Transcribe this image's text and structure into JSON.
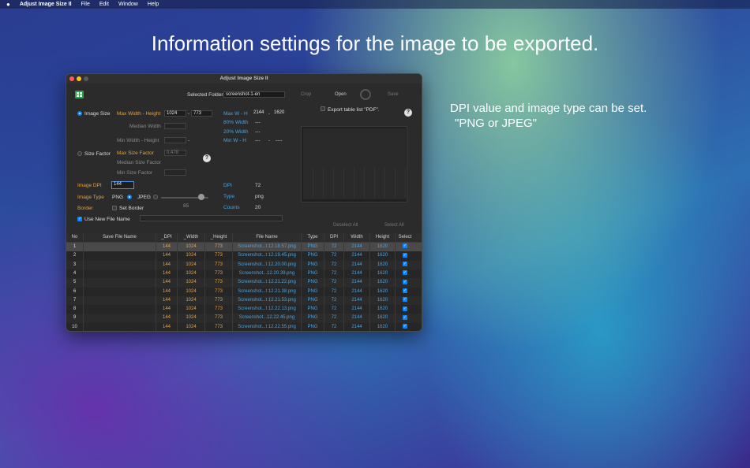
{
  "menubar": {
    "apple": "",
    "app": "Adjust Image Size II",
    "items": [
      "File",
      "Edit",
      "Window",
      "Help"
    ]
  },
  "headline": "Information settings for the image to be exported.",
  "side_note": [
    "DPI value and image type can be set.",
    "\"PNG or JPEG\""
  ],
  "window": {
    "title": "Adjust Image Size II",
    "toolbar": {
      "selected_folder_label": "Selected Folder",
      "selected_folder_value": "screenshot-1-en",
      "crop": "Crop",
      "open": "Open",
      "save": "Save"
    },
    "export_pdf_label": "Export table list \"PDF\".",
    "image_size": {
      "label": "Image Size",
      "max_wh_label": "Max Width - Height",
      "max_w": "1024",
      "max_h": "773",
      "median_width_label": "Median Width",
      "min_wh_label": "Min Width - Height",
      "dash": "-"
    },
    "right_info": {
      "max_wh_label": "Max W - H",
      "max_w": "2144",
      "max_h": "1620",
      "w80_label": "80% Width",
      "w80": "---",
      "w20_label": "20% Width",
      "w20": "---",
      "min_wh_label": "Min W - H",
      "min_w": "---",
      "min_h": "----"
    },
    "size_factor": {
      "label": "Size Factor",
      "max_label": "Max Size Factor",
      "max_value": "0.478",
      "median_label": "Median Size Factor",
      "min_label": "Min Size Factor"
    },
    "image_dpi_label": "Image DPI",
    "image_dpi_value": "144",
    "image_type_label": "Image Type",
    "png": "PNG",
    "jpeg": "JPEG",
    "quality": "85",
    "quality_fraction": 0.85,
    "border_label": "Border",
    "set_border": "Set Border",
    "use_new_file_name": "Use New File Name",
    "stats": {
      "dpi_label": "DPI",
      "dpi": "72",
      "type_label": "Type",
      "type": "png",
      "counts_label": "Counts",
      "counts": "20"
    },
    "deselect_all": "Deselect All",
    "select_all": "Select All",
    "table": {
      "headers": [
        "No",
        "Save File Name",
        "_DPI",
        "_Width",
        "_Height",
        "File Name",
        "Type",
        "DPI",
        "Width",
        "Height",
        "Select"
      ],
      "rows": [
        [
          "1",
          "",
          "144",
          "1024",
          "773",
          "Screenshot...t 12.18.57.png",
          "PNG",
          "72",
          "2144",
          "1620"
        ],
        [
          "2",
          "",
          "144",
          "1024",
          "773",
          "Screenshot...t 12.19.45.png",
          "PNG",
          "72",
          "2144",
          "1620"
        ],
        [
          "3",
          "",
          "144",
          "1024",
          "773",
          "Screenshot...t 12.20.00.png",
          "PNG",
          "72",
          "2144",
          "1620"
        ],
        [
          "4",
          "",
          "144",
          "1024",
          "773",
          "Screenshot...12.20.39.png",
          "PNG",
          "72",
          "2144",
          "1620"
        ],
        [
          "5",
          "",
          "144",
          "1024",
          "773",
          "Screenshot...t 12.21.22.png",
          "PNG",
          "72",
          "2144",
          "1620"
        ],
        [
          "6",
          "",
          "144",
          "1024",
          "773",
          "Screenshot...t 12.21.38.png",
          "PNG",
          "72",
          "2144",
          "1620"
        ],
        [
          "7",
          "",
          "144",
          "1024",
          "773",
          "Screenshot...t 12.21.53.png",
          "PNG",
          "72",
          "2144",
          "1620"
        ],
        [
          "8",
          "",
          "144",
          "1024",
          "773",
          "Screenshot...t 12.22.13.png",
          "PNG",
          "72",
          "2144",
          "1620"
        ],
        [
          "9",
          "",
          "144",
          "1024",
          "773",
          "Screenshot...12.22.45.png",
          "PNG",
          "72",
          "2144",
          "1620"
        ],
        [
          "10",
          "",
          "144",
          "1024",
          "773",
          "Screenshot...t 12.22.55.png",
          "PNG",
          "72",
          "2144",
          "1620"
        ]
      ]
    }
  }
}
